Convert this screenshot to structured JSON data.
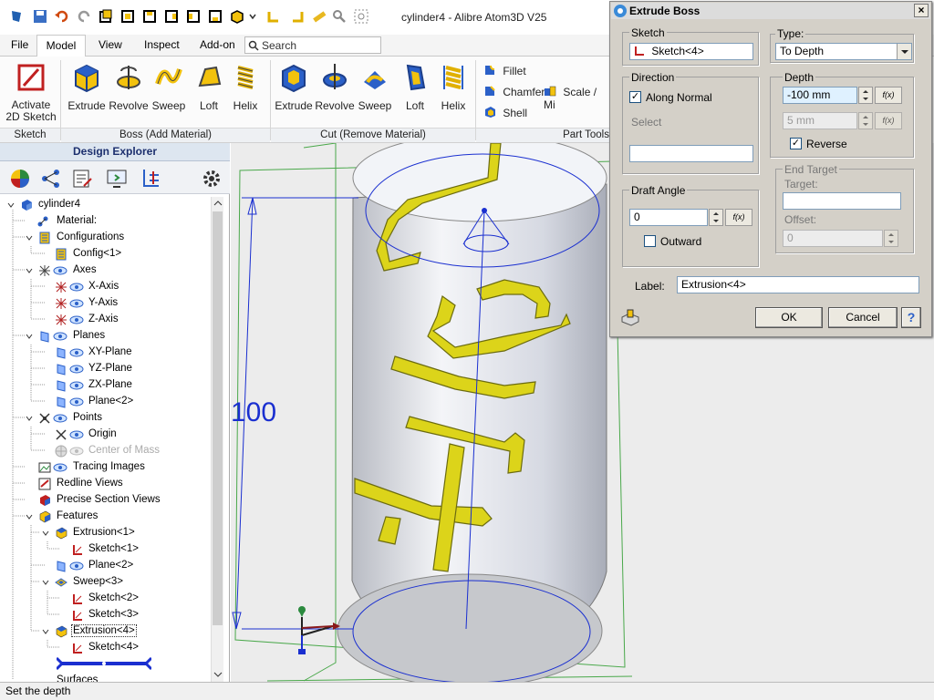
{
  "window": {
    "title": "cylinder4 - Alibre Atom3D V25"
  },
  "menu": {
    "tabs": [
      "File",
      "Model",
      "View",
      "Inspect",
      "Add-on"
    ],
    "active": "Model",
    "search_placeholder": "Search"
  },
  "ribbon": {
    "sketch": {
      "button": "Activate\n2D Sketch",
      "group": "Sketch"
    },
    "boss": {
      "buttons": [
        "Extrude",
        "Revolve",
        "Sweep",
        "Loft",
        "Helix"
      ],
      "group": "Boss (Add Material)"
    },
    "cut": {
      "buttons": [
        "Extrude",
        "Revolve",
        "Sweep",
        "Loft",
        "Helix"
      ],
      "group": "Cut (Remove Material)"
    },
    "tools": {
      "fillet": "Fillet",
      "chamfer": "Chamfer",
      "scale": "Scale / Mi",
      "shell": "Shell",
      "group": "Part Tools"
    }
  },
  "explorer": {
    "title": "Design Explorer",
    "tree": [
      {
        "label": "cylinder4"
      },
      {
        "label": "Material:"
      },
      {
        "label": "Configurations"
      },
      {
        "label": "Config<1>"
      },
      {
        "label": "Axes"
      },
      {
        "label": "X-Axis"
      },
      {
        "label": "Y-Axis"
      },
      {
        "label": "Z-Axis"
      },
      {
        "label": "Planes"
      },
      {
        "label": "XY-Plane"
      },
      {
        "label": "YZ-Plane"
      },
      {
        "label": "ZX-Plane"
      },
      {
        "label": "Plane<2>"
      },
      {
        "label": "Points"
      },
      {
        "label": "Origin"
      },
      {
        "label": "Center of Mass"
      },
      {
        "label": "Tracing Images"
      },
      {
        "label": "Redline Views"
      },
      {
        "label": "Precise Section Views"
      },
      {
        "label": "Features"
      },
      {
        "label": "Extrusion<1>"
      },
      {
        "label": "Sketch<1>"
      },
      {
        "label": "Plane<2>"
      },
      {
        "label": "Sweep<3>"
      },
      {
        "label": "Sketch<2>"
      },
      {
        "label": "Sketch<3>"
      },
      {
        "label": "Extrusion<4>"
      },
      {
        "label": "Sketch<4>"
      },
      {
        "label": "Surfaces"
      }
    ]
  },
  "viewport": {
    "dimension": "100"
  },
  "dialog": {
    "title": "Extrude Boss",
    "sketch": {
      "group": "Sketch",
      "value": "Sketch<4>"
    },
    "direction": {
      "group": "Direction",
      "along_normal": "Along Normal",
      "along_normal_checked": true,
      "select": "Select"
    },
    "draft": {
      "group": "Draft Angle",
      "value": "0",
      "outward": "Outward",
      "outward_checked": false
    },
    "type": {
      "group": "Type:",
      "value": "To Depth"
    },
    "depth": {
      "group": "Depth",
      "value1": "-100 mm",
      "value2": "5 mm",
      "reverse": "Reverse",
      "reverse_checked": true,
      "fx": "f(x)"
    },
    "end_target": {
      "group": "End Target",
      "target": "Target:",
      "offset": "Offset:",
      "offset_value": "0"
    },
    "label": {
      "caption": "Label:",
      "value": "Extrusion<4>"
    },
    "buttons": {
      "ok": "OK",
      "cancel": "Cancel",
      "help": "?"
    }
  },
  "status": {
    "text": "Set the depth"
  }
}
